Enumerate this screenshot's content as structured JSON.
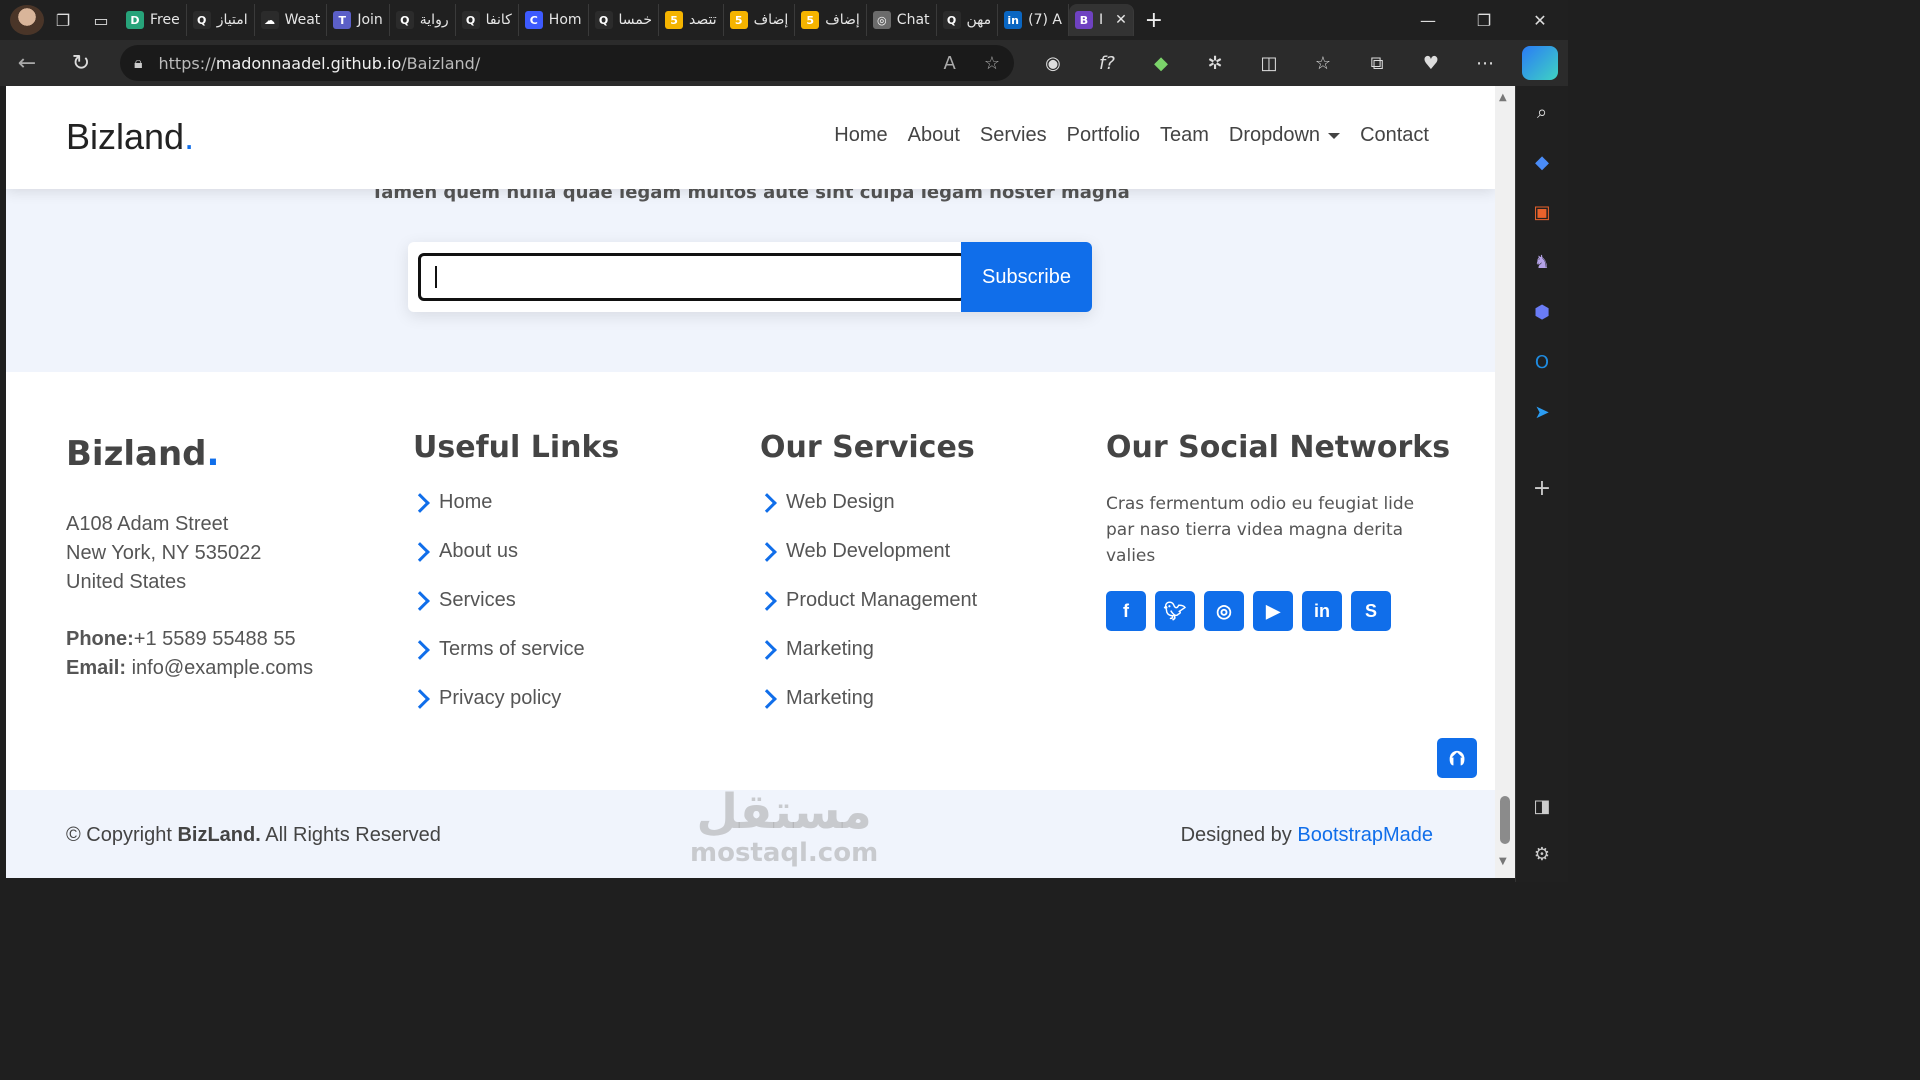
{
  "browser": {
    "tabs": [
      {
        "label": "Free",
        "fav": "D",
        "color": "#27a37a"
      },
      {
        "label": "امتياز",
        "fav": "Q",
        "color": "#2b2b2b"
      },
      {
        "label": "Weat",
        "fav": "☁",
        "color": "#2b2b2b"
      },
      {
        "label": "Join",
        "fav": "T",
        "color": "#5b5fc7"
      },
      {
        "label": "رواية",
        "fav": "Q",
        "color": "#2b2b2b"
      },
      {
        "label": "كانفا",
        "fav": "Q",
        "color": "#2b2b2b"
      },
      {
        "label": "Hom",
        "fav": "C",
        "color": "#3d5afe"
      },
      {
        "label": "خمسا",
        "fav": "Q",
        "color": "#2b2b2b"
      },
      {
        "label": "تتصد",
        "fav": "5",
        "color": "#f5b400"
      },
      {
        "label": "إضاف",
        "fav": "5",
        "color": "#f5b400"
      },
      {
        "label": "إضاف",
        "fav": "5",
        "color": "#f5b400"
      },
      {
        "label": "Chat",
        "fav": "◎",
        "color": "#6b6b6b"
      },
      {
        "label": "مهن",
        "fav": "Q",
        "color": "#2b2b2b"
      },
      {
        "label": "(7) A",
        "fav": "in",
        "color": "#0a66c2"
      },
      {
        "label": "I",
        "fav": "B",
        "color": "#6f42c1"
      }
    ],
    "url_prefix": "https://",
    "url_host": "madonnaadel.github.io",
    "url_path": "/Baizland/"
  },
  "header": {
    "logo": "Bizland",
    "logo_dot": ".",
    "nav": [
      "Home",
      "About",
      "Servies",
      "Portfolio",
      "Team",
      "Dropdown",
      "Contact"
    ]
  },
  "newsletter": {
    "cut_text": "Tamen quem nulla quae legam multos aute sint culpa legam noster magna",
    "input_value": "",
    "button": "Subscribe"
  },
  "footer": {
    "logo": "Bizland",
    "logo_dot": ".",
    "address": [
      "A108 Adam Street",
      "New York, NY 535022",
      "United States"
    ],
    "phone_label": "Phone:",
    "phone": "+1 5589 55488 55",
    "email_label": "Email:",
    "email": "info@example.coms",
    "useful_links_title": "Useful Links",
    "useful_links": [
      "Home",
      "About us",
      "Services",
      "Terms of service",
      "Privacy policy"
    ],
    "services_title": "Our Services",
    "services": [
      "Web Design",
      "Web Development",
      "Product Management",
      "Marketing",
      "Marketing"
    ],
    "social_title": "Our Social Networks",
    "social_text": "Cras fermentum odio eu feugiat lide par naso tierra videa magna derita valies",
    "social_icons": [
      "facebook-icon",
      "twitter-icon",
      "instagram-icon",
      "youtube-icon",
      "linkedin-icon",
      "skype-icon"
    ],
    "copyright_pre": "© Copyright ",
    "copyright_brand": "BizLand.",
    "copyright_post": " All Rights Reserved",
    "designed_by": "Designed by ",
    "designer": "BootstrapMade"
  },
  "watermark": {
    "arabic": "مستقل",
    "latin": "mostaql.com"
  },
  "colors": {
    "accent": "#106eea",
    "section_bg": "#f0f4fc"
  }
}
